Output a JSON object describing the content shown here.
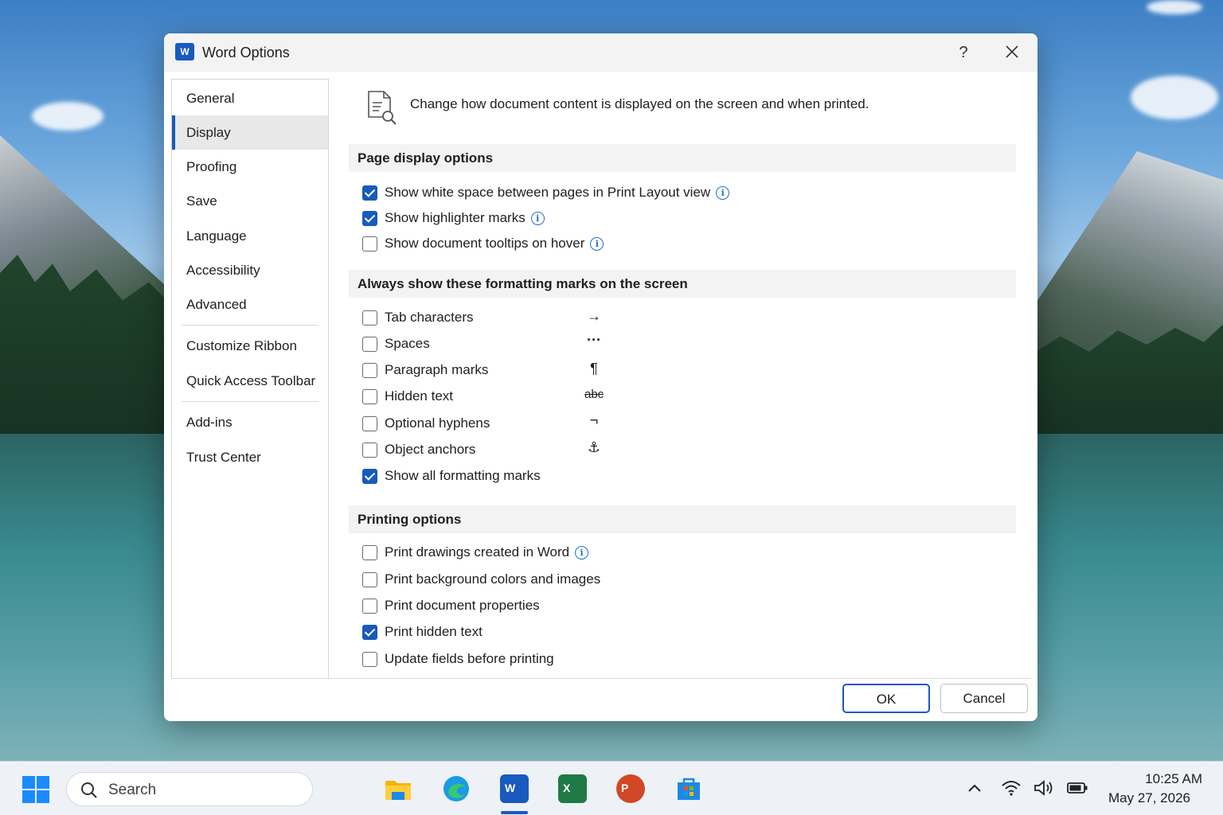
{
  "dialog": {
    "title": "Word Options",
    "help_label": "?",
    "close_label": "✕",
    "app_icon_letter": "W"
  },
  "nav": {
    "items": [
      {
        "label": "General"
      },
      {
        "label": "Display"
      },
      {
        "label": "Proofing"
      },
      {
        "label": "Save"
      },
      {
        "label": "Language"
      },
      {
        "label": "Accessibility"
      },
      {
        "label": "Advanced"
      },
      {
        "label": "Customize Ribbon"
      },
      {
        "label": "Quick Access Toolbar"
      },
      {
        "label": "Add-ins"
      },
      {
        "label": "Trust Center"
      }
    ],
    "active": "Display"
  },
  "content": {
    "header": "Change how document content is displayed on the screen and when printed.",
    "page_display": {
      "title": "Page display options",
      "options": [
        {
          "label": "Show white space between pages in Print Layout view",
          "checked": true,
          "info": true
        },
        {
          "label": "Show highlighter marks",
          "checked": true,
          "info": true
        },
        {
          "label": "Show document tooltips on hover",
          "checked": false,
          "info": true
        }
      ]
    },
    "formatting_marks": {
      "title": "Always show these formatting marks on the screen",
      "options": [
        {
          "label": "Tab characters",
          "checked": false,
          "symbol": "→"
        },
        {
          "label": "Spaces",
          "checked": false,
          "symbol": "···"
        },
        {
          "label": "Paragraph marks",
          "checked": false,
          "symbol": "¶"
        },
        {
          "label": "Hidden text",
          "checked": false,
          "symbol": "abc"
        },
        {
          "label": "Optional hyphens",
          "checked": false,
          "symbol": "¬"
        },
        {
          "label": "Object anchors",
          "checked": false,
          "symbol": "⚓"
        },
        {
          "label": "Show all formatting marks",
          "checked": true
        }
      ]
    },
    "printing": {
      "title": "Printing options",
      "options": [
        {
          "label": "Print drawings created in Word",
          "checked": false,
          "info": true
        },
        {
          "label": "Print background colors and images",
          "checked": false
        },
        {
          "label": "Print document properties",
          "checked": false
        },
        {
          "label": "Print hidden text",
          "checked": true
        },
        {
          "label": "Update fields before printing",
          "checked": false
        }
      ]
    }
  },
  "buttons": {
    "ok": "OK",
    "cancel": "Cancel"
  },
  "taskbar": {
    "search_placeholder": "Search",
    "apps": [
      "file-explorer",
      "edge",
      "word",
      "excel",
      "powerpoint",
      "store"
    ],
    "active_app": "word",
    "time": "10:25 AM",
    "date": "May 27, 2026"
  },
  "colors": {
    "accent": "#185abd",
    "info": "#1f6fd1"
  }
}
